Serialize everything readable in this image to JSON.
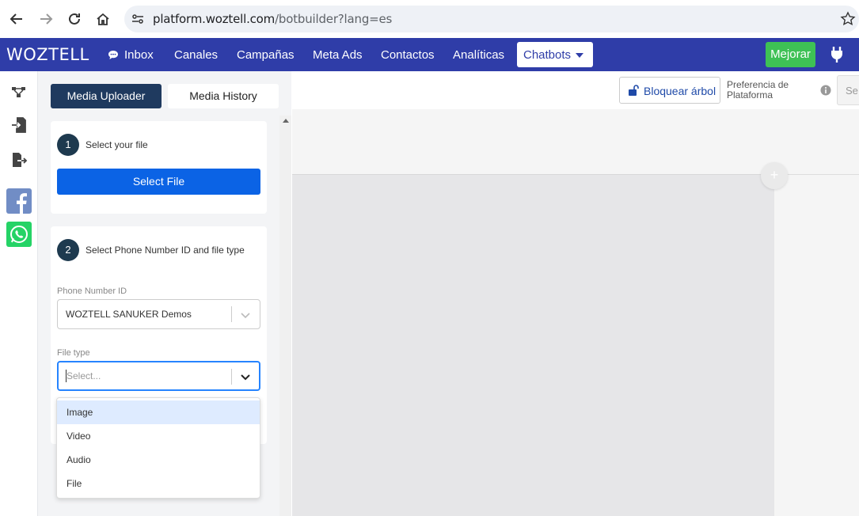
{
  "browser": {
    "url_host": "platform.woztell.com",
    "url_path": "/botbuilder?lang=es"
  },
  "header": {
    "logo": "WOZTELL",
    "nav": [
      "Inbox",
      "Canales",
      "Campañas",
      "Meta Ads",
      "Contactos",
      "Analíticas"
    ],
    "chatbots_label": "Chatbots",
    "upgrade_label": "Mejorar",
    "colors": {
      "brand": "#2f3da8",
      "upgrade": "#3ec155"
    }
  },
  "tabs": {
    "uploader": "Media Uploader",
    "history": "Media History"
  },
  "step1": {
    "number": "1",
    "label": "Select your file",
    "button": "Select File"
  },
  "step2": {
    "number": "2",
    "label": "Select Phone Number ID and file type",
    "phone_label": "Phone Number ID",
    "phone_value": "WOZTELL SANUKER Demos",
    "filetype_label": "File type",
    "filetype_placeholder": "Select..."
  },
  "filetype_options": [
    "Image",
    "Video",
    "Audio",
    "File"
  ],
  "toolbar": {
    "lock_label": "Bloquear árbol",
    "pref_label": "Preferencia de Plataforma",
    "search_placeholder": "Se"
  },
  "canvas": {
    "plus": "+"
  }
}
